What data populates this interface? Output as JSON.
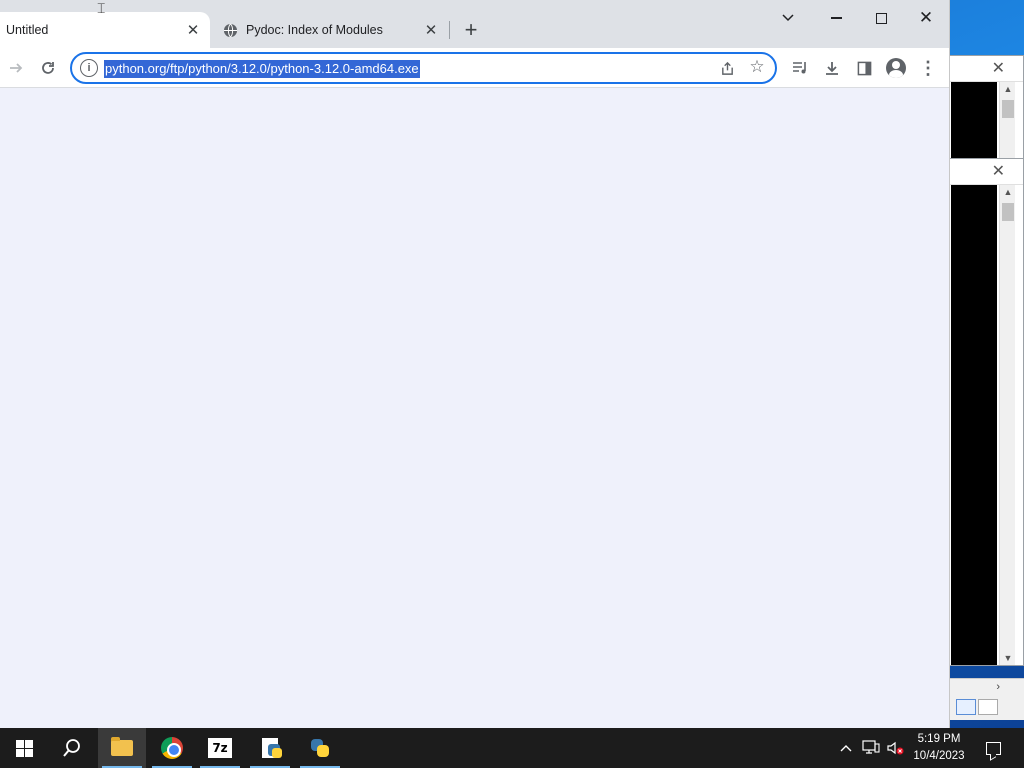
{
  "browser": {
    "tabs": [
      {
        "title": "Untitled",
        "active": true
      },
      {
        "title": "Pydoc: Index of Modules",
        "active": false,
        "favicon": "globe-icon"
      }
    ],
    "new_tab_symbol": "+",
    "address_bar": {
      "url": "python.org/ftp/python/3.12.0/python-3.12.0-amd64.exe",
      "selected": true
    },
    "theme": {
      "accent": "#1a73e8",
      "selection": "#3367d6",
      "content_bg": "#eff1fb"
    }
  },
  "taskbar": {
    "apps": [
      {
        "name": "File Explorer",
        "icon": "folder-icon"
      },
      {
        "name": "Google Chrome",
        "icon": "chrome-icon"
      },
      {
        "name": "7-Zip",
        "icon": "sevenzip-icon",
        "label": "7z"
      },
      {
        "name": "Python Installer",
        "icon": "python-setup-icon"
      },
      {
        "name": "Python",
        "icon": "python-icon"
      }
    ],
    "clock": {
      "time": "5:19 PM",
      "date": "10/4/2023"
    }
  }
}
